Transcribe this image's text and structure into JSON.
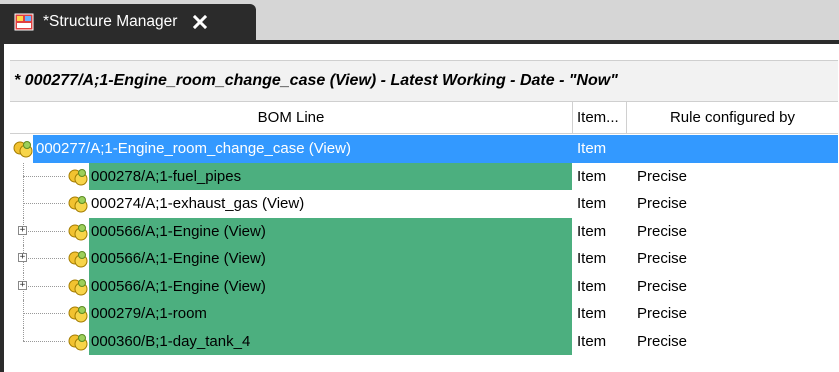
{
  "tab": {
    "title": "*Structure Manager",
    "icon": "structure-manager-icon",
    "close_icon": "close-icon"
  },
  "view_header": {
    "text": "* 000277/A;1-Engine_room_change_case (View) - Latest Working - Date - \"Now\""
  },
  "columns": {
    "bom_line": "BOM Line",
    "item_type": "Item...",
    "rule": "Rule configured by"
  },
  "rows": [
    {
      "label": "000277/A;1-Engine_room_change_case (View)",
      "type": "Item",
      "rule": "",
      "highlight": "selected",
      "expander": ""
    },
    {
      "label": "000278/A;1-fuel_pipes",
      "type": "Item",
      "rule": "Precise",
      "highlight": "green",
      "expander": ""
    },
    {
      "label": "000274/A;1-exhaust_gas (View)",
      "type": "Item",
      "rule": "Precise",
      "highlight": "none",
      "expander": ""
    },
    {
      "label": "000566/A;1-Engine (View)",
      "type": "Item",
      "rule": "Precise",
      "highlight": "green",
      "expander": "+"
    },
    {
      "label": "000566/A;1-Engine (View)",
      "type": "Item",
      "rule": "Precise",
      "highlight": "green",
      "expander": "+"
    },
    {
      "label": "000566/A;1-Engine (View)",
      "type": "Item",
      "rule": "Precise",
      "highlight": "green",
      "expander": "+"
    },
    {
      "label": "000279/A;1-room",
      "type": "Item",
      "rule": "Precise",
      "highlight": "green",
      "expander": ""
    },
    {
      "label": "000360/B;1-day_tank_4",
      "type": "Item",
      "rule": "Precise",
      "highlight": "green",
      "expander": ""
    }
  ],
  "colors": {
    "selection": "#3399ff",
    "changed_highlight": "#4caf7f",
    "tab_background": "#2b2b2b"
  }
}
